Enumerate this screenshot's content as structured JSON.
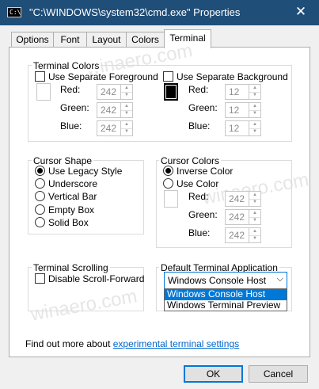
{
  "window": {
    "title": "\"C:\\WINDOWS\\system32\\cmd.exe\" Properties",
    "icon_text": "C:\\",
    "close_glyph": "✕"
  },
  "tabs": [
    {
      "label": "Options",
      "active": false
    },
    {
      "label": "Font",
      "active": false
    },
    {
      "label": "Layout",
      "active": false
    },
    {
      "label": "Colors",
      "active": false
    },
    {
      "label": "Terminal",
      "active": true
    }
  ],
  "terminal_colors": {
    "group_label": "Terminal Colors",
    "foreground": {
      "label": "Use Separate Foreground",
      "checked": false,
      "red_label": "Red:",
      "green_label": "Green:",
      "blue_label": "Blue:",
      "red": "242",
      "green": "242",
      "blue": "242"
    },
    "background": {
      "label": "Use Separate Background",
      "checked": false,
      "red_label": "Red:",
      "green_label": "Green:",
      "blue_label": "Blue:",
      "red": "12",
      "green": "12",
      "blue": "12"
    }
  },
  "cursor_shape": {
    "group_label": "Cursor Shape",
    "options": [
      "Use Legacy Style",
      "Underscore",
      "Vertical Bar",
      "Empty Box",
      "Solid Box"
    ],
    "selected": "Use Legacy Style"
  },
  "cursor_colors": {
    "group_label": "Cursor Colors",
    "inverse_label": "Inverse Color",
    "use_color_label": "Use Color",
    "selected": "Inverse Color",
    "red_label": "Red:",
    "green_label": "Green:",
    "blue_label": "Blue:",
    "red": "242",
    "green": "242",
    "blue": "242"
  },
  "terminal_scrolling": {
    "group_label": "Terminal Scrolling",
    "disable_label": "Disable Scroll-Forward",
    "checked": false
  },
  "default_terminal": {
    "group_label": "Default Terminal Application",
    "selected": "Windows Console Host",
    "options": [
      "Windows Console Host",
      "Windows Terminal Preview"
    ],
    "arrow_glyph": "⌵"
  },
  "footer": {
    "find_out_prefix": "Find out more about",
    "find_out_link": "experimental terminal settings",
    "ok_label": "OK",
    "cancel_label": "Cancel"
  },
  "watermark": "winaero.com",
  "colors": {
    "titlebar": "#1f4e79",
    "accent": "#0078d7",
    "link": "#0066cc"
  }
}
